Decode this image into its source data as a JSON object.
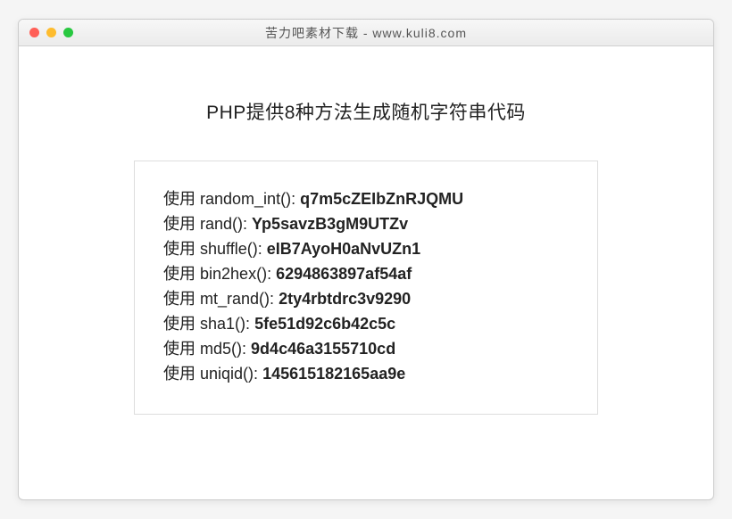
{
  "titlebar": {
    "title": "苦力吧素材下载 - www.kuli8.com"
  },
  "heading": "PHP提供8种方法生成随机字符串代码",
  "label_prefix": "使用 ",
  "results": [
    {
      "func": "random_int()",
      "value": "q7m5cZEIbZnRJQMU"
    },
    {
      "func": "rand()",
      "value": "Yp5savzB3gM9UTZv"
    },
    {
      "func": "shuffle()",
      "value": "eIB7AyoH0aNvUZn1"
    },
    {
      "func": "bin2hex()",
      "value": "6294863897af54af"
    },
    {
      "func": "mt_rand()",
      "value": "2ty4rbtdrc3v9290"
    },
    {
      "func": "sha1()",
      "value": "5fe51d92c6b42c5c"
    },
    {
      "func": "md5()",
      "value": "9d4c46a3155710cd"
    },
    {
      "func": "uniqid()",
      "value": "145615182165aa9e"
    }
  ]
}
